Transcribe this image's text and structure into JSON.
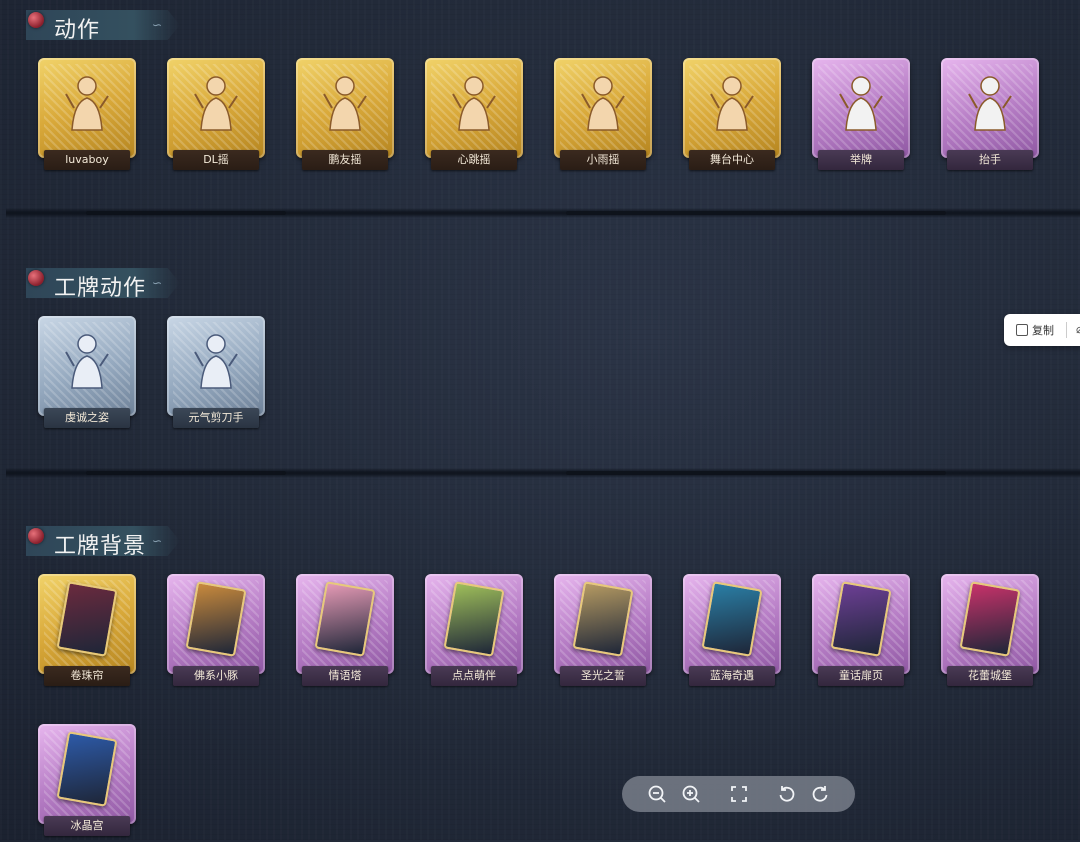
{
  "sections": [
    {
      "title": "动作",
      "items": [
        {
          "label": "luvaboy",
          "tier": "gold",
          "icon": "dance-pose-icon"
        },
        {
          "label": "DL摇",
          "tier": "gold",
          "icon": "dance-pose-icon"
        },
        {
          "label": "鹏友摇",
          "tier": "gold",
          "icon": "dance-pose-icon"
        },
        {
          "label": "心跳摇",
          "tier": "gold",
          "icon": "dance-pose-icon"
        },
        {
          "label": "小雨摇",
          "tier": "gold",
          "icon": "dance-pose-icon"
        },
        {
          "label": "舞台中心",
          "tier": "gold",
          "icon": "dance-pose-icon"
        },
        {
          "label": "举牌",
          "tier": "purple",
          "icon": "hold-sign-icon"
        },
        {
          "label": "抬手",
          "tier": "purple",
          "icon": "raise-hand-icon"
        }
      ]
    },
    {
      "title": "工牌动作",
      "items": [
        {
          "label": "虔诚之姿",
          "tier": "silver",
          "icon": "badge-pose-icon"
        },
        {
          "label": "元气剪刀手",
          "tier": "silver",
          "icon": "badge-pose-icon"
        }
      ]
    },
    {
      "title": "工牌背景",
      "items": [
        {
          "label": "卷珠帘",
          "tier": "gold",
          "icon": "curtain-card-icon",
          "art": "#6b2a3e"
        },
        {
          "label": "佛系小豚",
          "tier": "purple",
          "icon": "door-card-icon",
          "art": "#c98a3c"
        },
        {
          "label": "情语塔",
          "tier": "purple",
          "icon": "tower-card-icon",
          "art": "#e59ab5"
        },
        {
          "label": "点点萌伴",
          "tier": "purple",
          "icon": "meadow-card-icon",
          "art": "#9fbf5a"
        },
        {
          "label": "圣光之誓",
          "tier": "purple",
          "icon": "light-card-icon",
          "art": "#b59a62"
        },
        {
          "label": "蓝海奇遇",
          "tier": "purple",
          "icon": "ocean-card-icon",
          "art": "#2a7fa6"
        },
        {
          "label": "童话扉页",
          "tier": "purple",
          "icon": "book-card-icon",
          "art": "#6d3f95"
        },
        {
          "label": "花蕾城堡",
          "tier": "purple",
          "icon": "castle-card-icon",
          "art": "#c8326a"
        },
        {
          "label": "冰晶宫",
          "tier": "purple",
          "icon": "ice-palace-card-icon",
          "art": "#2d5aa8"
        }
      ]
    }
  ],
  "popup": {
    "copy_label": "复制"
  },
  "toolbar": {
    "buttons": [
      "zoom-out-icon",
      "zoom-in-icon",
      "fit-screen-icon",
      "rotate-left-icon",
      "rotate-right-icon"
    ]
  },
  "colors": {
    "background": "#222a39",
    "gold": "#d9a93a",
    "purple": "#b57cc4",
    "silver": "#95a9bf"
  }
}
